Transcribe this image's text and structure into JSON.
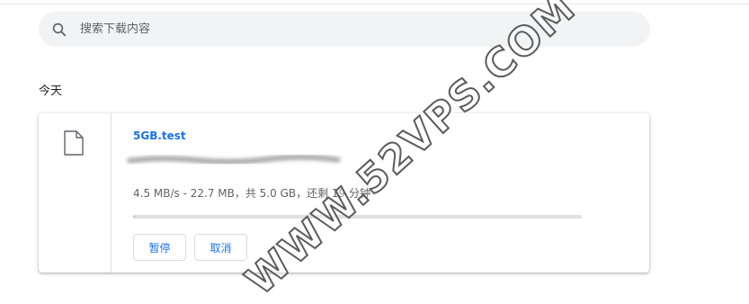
{
  "search": {
    "placeholder": "搜索下载内容",
    "icon": "search-icon"
  },
  "section": {
    "date_label": "今天"
  },
  "download": {
    "file_name": "5GB.test",
    "status": "4.5 MB/s - 22.7 MB，共 5.0 GB，还剩 19 分钟",
    "progress_fraction": 0.0045,
    "pause_label": "暂停",
    "cancel_label": "取消",
    "icon": "file-icon"
  },
  "watermark": {
    "text": "WWW.52VPS.COM"
  },
  "colors": {
    "link": "#1a73e8",
    "search_bg": "#f1f3f4",
    "secondary_text": "#5f6368"
  }
}
